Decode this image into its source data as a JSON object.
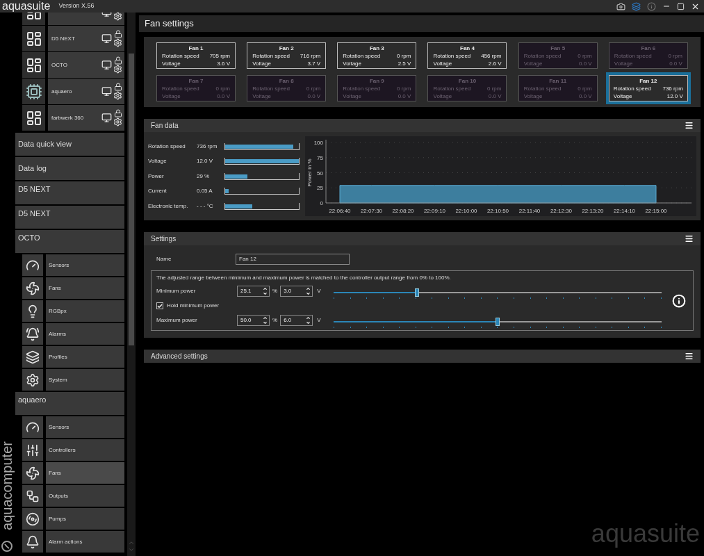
{
  "titlebar": {
    "app_name": "aquasuite",
    "version": "Version X.56"
  },
  "sidebar": {
    "devices": [
      {
        "kind": "partial"
      },
      {
        "name": "D5 NEXT",
        "kind": "full"
      },
      {
        "name": "OCTO",
        "kind": "full"
      },
      {
        "name": "aquaero",
        "kind": "full"
      },
      {
        "name": "farbwerk 360",
        "kind": "full"
      }
    ],
    "items": [
      {
        "label": "Data quick view",
        "kind": "page"
      },
      {
        "label": "Data log",
        "kind": "page"
      },
      {
        "label": "D5 NEXT",
        "kind": "group"
      },
      {
        "label": "D5 NEXT",
        "kind": "group"
      },
      {
        "label": "OCTO",
        "kind": "group",
        "children": [
          {
            "label": "Sensors",
            "selected": false
          },
          {
            "label": "Fans",
            "selected": false
          },
          {
            "label": "RGBpx",
            "selected": false
          },
          {
            "label": "Alarms",
            "selected": false
          },
          {
            "label": "Profiles",
            "selected": false
          },
          {
            "label": "System",
            "selected": false
          }
        ]
      },
      {
        "label": "aquaero",
        "kind": "group",
        "children": [
          {
            "label": "Sensors",
            "selected": false
          },
          {
            "label": "Controllers",
            "selected": false
          },
          {
            "label": "Fans",
            "selected": true
          },
          {
            "label": "Outputs",
            "selected": false
          },
          {
            "label": "Pumps",
            "selected": false
          },
          {
            "label": "Alarm actions",
            "selected": false
          }
        ]
      }
    ],
    "vertical_logo": "aquacomputer"
  },
  "page_title": "Fan settings",
  "fans": [
    {
      "name": "Fan 1",
      "speed_label": "Rotation speed",
      "speed": "705 rpm",
      "voltage_label": "Voltage",
      "voltage": "3.6 V",
      "disabled": false,
      "selected": false
    },
    {
      "name": "Fan 2",
      "speed_label": "Rotation speed",
      "speed": "716 rpm",
      "voltage_label": "Voltage",
      "voltage": "3.7 V",
      "disabled": false,
      "selected": false
    },
    {
      "name": "Fan 3",
      "speed_label": "Rotation speed",
      "speed": "0 rpm",
      "voltage_label": "Voltage",
      "voltage": "2.5 V",
      "disabled": false,
      "selected": false
    },
    {
      "name": "Fan 4",
      "speed_label": "Rotation speed",
      "speed": "456 rpm",
      "voltage_label": "Voltage",
      "voltage": "2.6 V",
      "disabled": false,
      "selected": false
    },
    {
      "name": "Fan 5",
      "speed_label": "Rotation speed",
      "speed": "0 rpm",
      "voltage_label": "Voltage",
      "voltage": "0.0 V",
      "disabled": true,
      "selected": false
    },
    {
      "name": "Fan 6",
      "speed_label": "Rotation speed",
      "speed": "0 rpm",
      "voltage_label": "Voltage",
      "voltage": "0.0 V",
      "disabled": true,
      "selected": false
    },
    {
      "name": "Fan 7",
      "speed_label": "Rotation speed",
      "speed": "0 rpm",
      "voltage_label": "Voltage",
      "voltage": "0.0 V",
      "disabled": true,
      "selected": false
    },
    {
      "name": "Fan 8",
      "speed_label": "Rotation speed",
      "speed": "0 rpm",
      "voltage_label": "Voltage",
      "voltage": "0.0 V",
      "disabled": true,
      "selected": false
    },
    {
      "name": "Fan 9",
      "speed_label": "Rotation speed",
      "speed": "0 rpm",
      "voltage_label": "Voltage",
      "voltage": "0.0 V",
      "disabled": true,
      "selected": false
    },
    {
      "name": "Fan 10",
      "speed_label": "Rotation speed",
      "speed": "0 rpm",
      "voltage_label": "Voltage",
      "voltage": "0.0 V",
      "disabled": true,
      "selected": false
    },
    {
      "name": "Fan 11",
      "speed_label": "Rotation speed",
      "speed": "0 rpm",
      "voltage_label": "Voltage",
      "voltage": "0.0 V",
      "disabled": true,
      "selected": false
    },
    {
      "name": "Fan 12",
      "speed_label": "Rotation speed",
      "speed": "736 rpm",
      "voltage_label": "Voltage",
      "voltage": "12.0 V",
      "disabled": false,
      "selected": true
    }
  ],
  "fan_data": {
    "title": "Fan data",
    "rows": [
      {
        "label": "Rotation speed",
        "value": "736 rpm",
        "level": 0.92
      },
      {
        "label": "Voltage",
        "value": "12.0 V",
        "level": 1.0
      },
      {
        "label": "Power",
        "value": "29 %",
        "level": 0.3
      },
      {
        "label": "Current",
        "value": "0.05 A",
        "level": 0.05
      },
      {
        "label": "Electronic temp.",
        "value": "- - - °C",
        "level": 0.37
      }
    ],
    "chart_data": {
      "type": "area",
      "ylabel": "Power in %",
      "categories": [
        "22:06:40",
        "22:07:30",
        "22:08:20",
        "22:09:10",
        "22:10:00",
        "22:10:50",
        "22:11:40",
        "22:12:30",
        "22:13:20",
        "22:14:10",
        "22:15:00"
      ],
      "series": [
        {
          "color": "#3d7e9e",
          "values": [
            29,
            29,
            29,
            29,
            29,
            29,
            29,
            29,
            29,
            29,
            29
          ]
        }
      ],
      "grid": true,
      "ylim": [
        0,
        100
      ],
      "yticks": [
        0,
        25,
        50,
        75,
        100
      ]
    }
  },
  "settings": {
    "title": "Settings",
    "name_label": "Name",
    "name_value": "Fan 12",
    "note": "The adjusted range between minimum and maximum power is matched to the controller output range from 0% to 100%.",
    "min_power": {
      "label": "Minimum power",
      "percent": "25.1",
      "percent_unit": "%",
      "volts": "3.0",
      "volts_unit": "V",
      "level": 0.255
    },
    "hold_min": {
      "label": "Hold minimum power",
      "checked": true
    },
    "max_power": {
      "label": "Maximum power",
      "percent": "50.0",
      "percent_unit": "%",
      "volts": "6.0",
      "volts_unit": "V",
      "level": 0.5
    }
  },
  "advanced": {
    "title": "Advanced settings"
  },
  "watermark_logo": "aquasuite"
}
